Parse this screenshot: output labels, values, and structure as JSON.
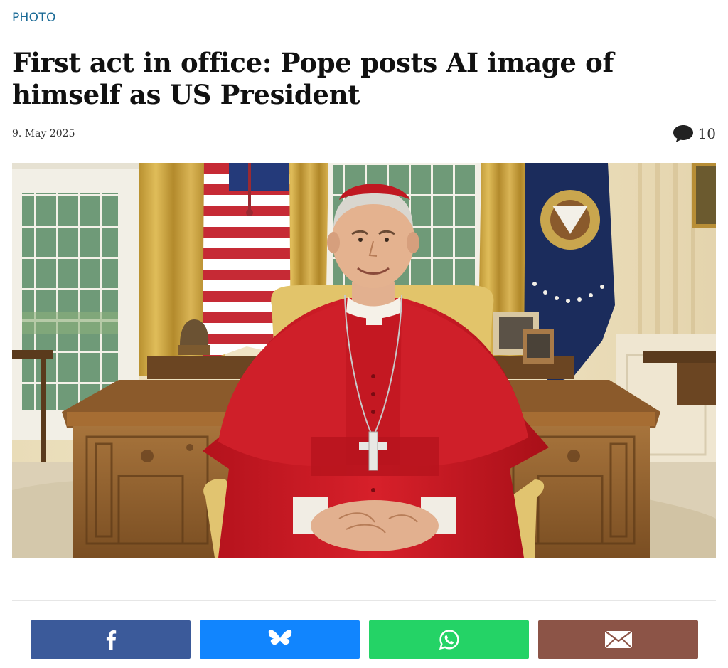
{
  "article": {
    "category": "PHOTO",
    "headline": "First act in office: Pope posts AI image of himself as US President",
    "date": "9. May 2025",
    "comment_count": "10"
  },
  "image": {
    "alt": "AI image of the Pope seated at the Resolute desk in the Oval Office, wearing red cardinal robes with a silver pectoral cross, US flag and presidential flag behind him"
  },
  "share_buttons": [
    {
      "service": "Facebook",
      "icon": "facebook-icon",
      "color": "#3b5a9a"
    },
    {
      "service": "Bluesky",
      "icon": "bluesky-butterfly-icon",
      "color": "#1185fe"
    },
    {
      "service": "WhatsApp",
      "icon": "whatsapp-icon",
      "color": "#24d366"
    },
    {
      "service": "Email",
      "icon": "envelope-icon",
      "color": "#8c5447"
    }
  ],
  "colors": {
    "category": "#1a6a96",
    "headline": "#111111"
  }
}
